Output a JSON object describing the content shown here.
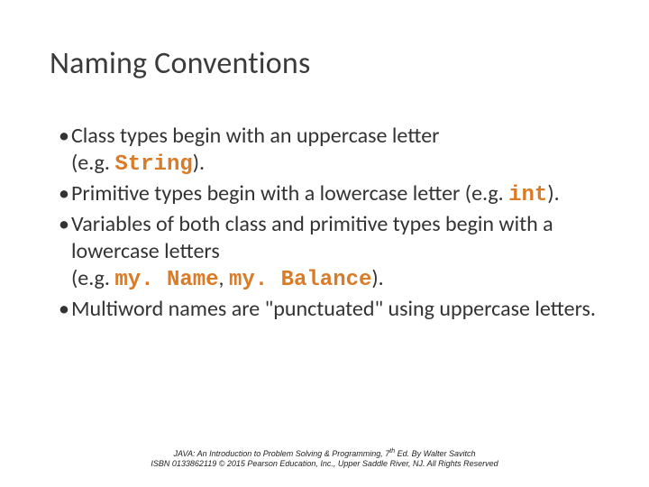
{
  "title": "Naming Conventions",
  "bullets": {
    "b1a": "Class types begin with an uppercase letter",
    "b1b": "(e.g. ",
    "b1code": "String",
    "b1c": ").",
    "b2a": "Primitive types begin with a lowercase letter (e.g. ",
    "b2code": "int",
    "b2b": ").",
    "b3a": "Variables of both class and primitive types begin with a lowercase letters",
    "b3b": "(e.g. ",
    "b3code1": "my. Name",
    "b3sep": ", ",
    "b3code2": "my. Balance",
    "b3c": ").",
    "b4": "Multiword names are \"punctuated\" using uppercase letters."
  },
  "footer": {
    "line1a": "JAVA: An Introduction to Problem Solving & Programming, 7",
    "line1sup": "th",
    "line1b": " Ed. By Walter Savitch",
    "line2": "ISBN 0133862119 © 2015 Pearson Education, Inc., Upper Saddle River, NJ. All Rights Reserved"
  }
}
